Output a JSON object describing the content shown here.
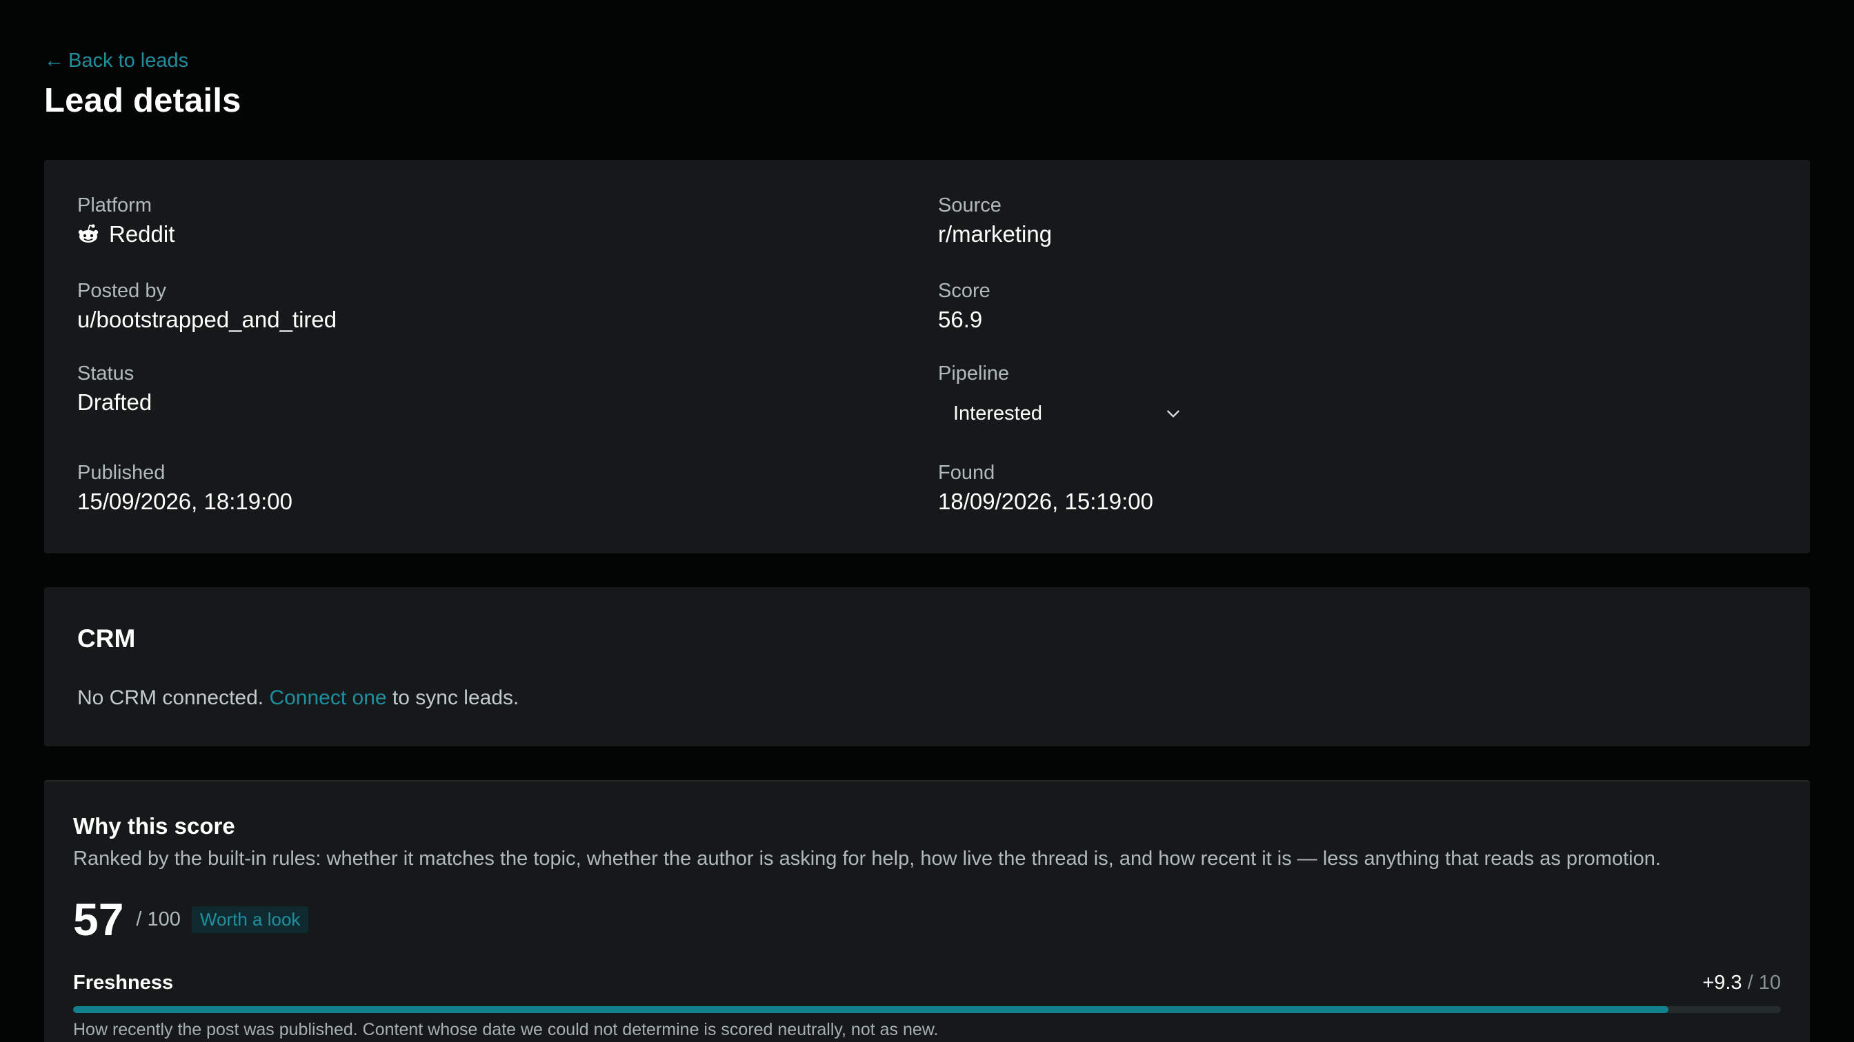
{
  "nav": {
    "back_label": "Back to leads",
    "back_arrow": "←"
  },
  "page": {
    "title": "Lead details"
  },
  "details": {
    "platform": {
      "label": "Platform",
      "value": "Reddit",
      "icon": "reddit-icon"
    },
    "source": {
      "label": "Source",
      "value": "r/marketing"
    },
    "posted_by": {
      "label": "Posted by",
      "value": "u/bootstrapped_and_tired"
    },
    "score": {
      "label": "Score",
      "value": "56.9"
    },
    "status": {
      "label": "Status",
      "value": "Drafted"
    },
    "pipeline": {
      "label": "Pipeline",
      "selected": "Interested"
    },
    "published": {
      "label": "Published",
      "value": "15/09/2026, 18:19:00"
    },
    "found": {
      "label": "Found",
      "value": "18/09/2026, 15:19:00"
    }
  },
  "crm": {
    "title": "CRM",
    "text_before": "No CRM connected. ",
    "link": "Connect one",
    "text_after": " to sync leads."
  },
  "score_breakdown": {
    "title": "Why this score",
    "description": "Ranked by the built-in rules: whether it matches the topic, whether the author is asking for help, how live the thread is, and how recent it is — less anything that reads as promotion.",
    "score": "57",
    "max": "/ 100",
    "badge": "Worth a look",
    "factors": [
      {
        "name": "Freshness",
        "value": "+9.3",
        "max": "/ 10",
        "fill_fraction": 0.934,
        "description": "How recently the post was published. Content whose date we could not determine is scored neutrally, not as new."
      }
    ]
  },
  "colors": {
    "accent": "#1f8fa0",
    "bar_fill": "#147f8f",
    "card_bg": "#161919",
    "page_bg": "#030404"
  }
}
